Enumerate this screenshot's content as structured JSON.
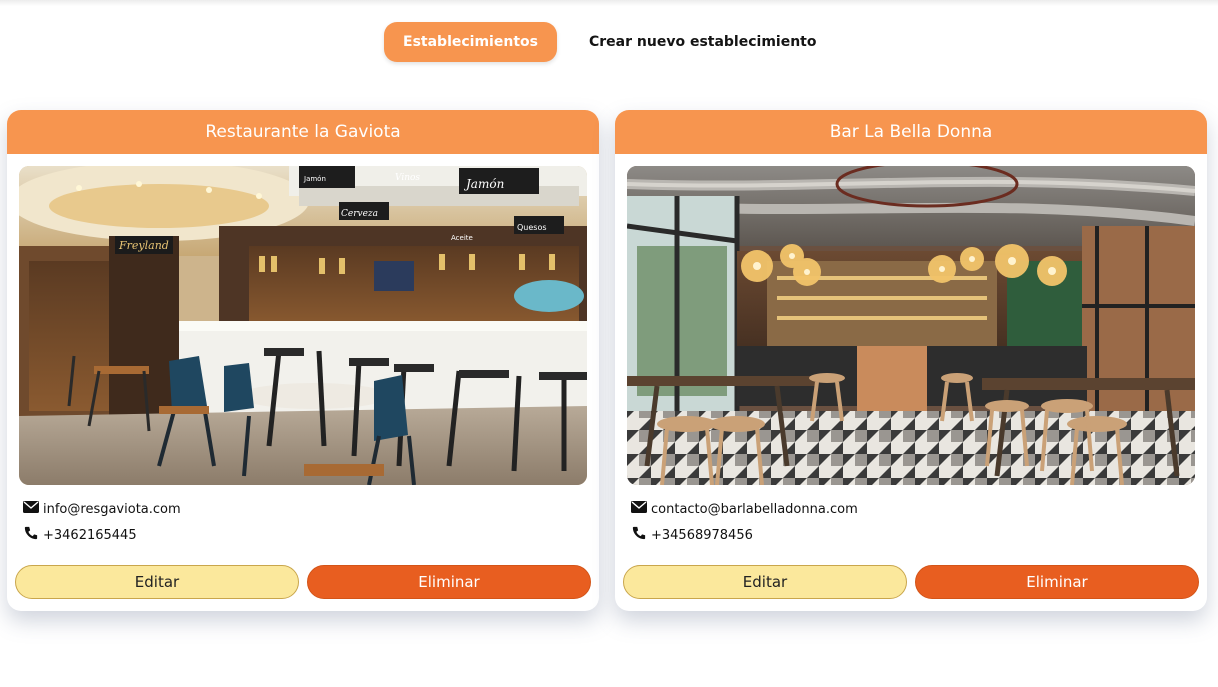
{
  "nav": {
    "tabs": [
      {
        "label": "Establecimientos",
        "active": true
      },
      {
        "label": "Crear nuevo establecimiento",
        "active": false
      }
    ]
  },
  "establishments": [
    {
      "name": "Restaurante la Gaviota",
      "email": "info@resgaviota.com",
      "phone": "+3462165445",
      "photo_icon": "restaurant-bar-photo",
      "signs": [
        "Freyland",
        "Cerveza",
        "Jamón",
        "Aceite",
        "Quesos",
        "Vinos",
        "Jamón"
      ],
      "edit_label": "Editar",
      "delete_label": "Eliminar"
    },
    {
      "name": "Bar La Bella Donna",
      "email": "contacto@barlabelladonna.com",
      "phone": "+34568978456",
      "photo_icon": "bar-interior-photo",
      "edit_label": "Editar",
      "delete_label": "Eliminar"
    }
  ],
  "colors": {
    "accent": "#f7954f",
    "edit_button": "#fbe89c",
    "delete_button": "#e85e20"
  },
  "icons": {
    "email": "envelope-icon",
    "phone": "phone-icon"
  }
}
